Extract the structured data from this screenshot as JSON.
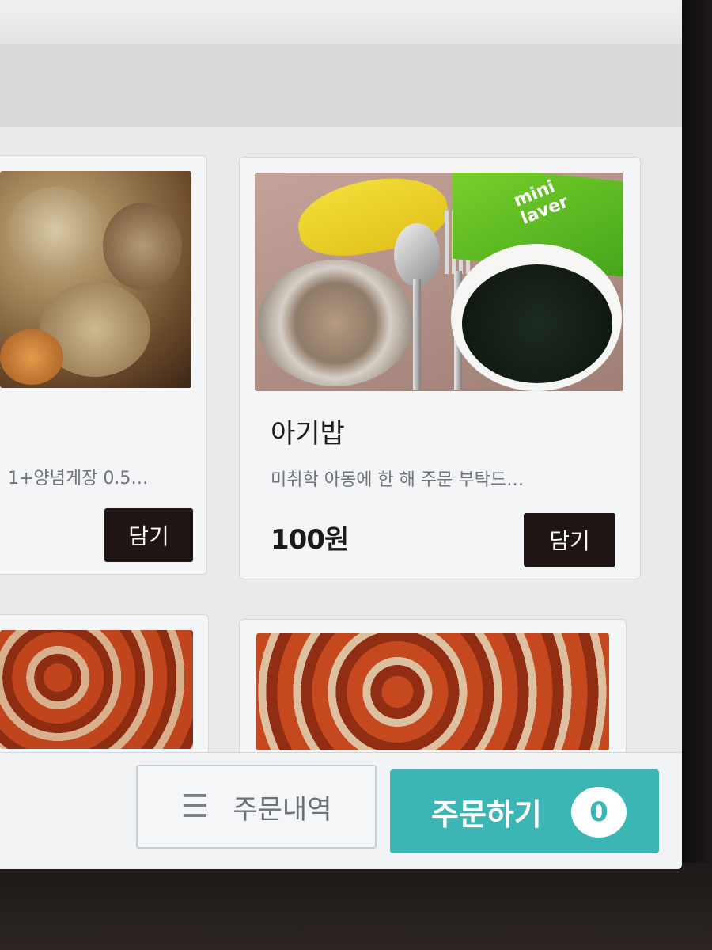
{
  "menu": {
    "items": [
      {
        "title": "",
        "description": "1+양념게장 0.5…",
        "price": "",
        "add_label": "담기"
      },
      {
        "title": "아기밥",
        "description": "미취학 아동에 한 해 주문 부탁드…",
        "price": "100원",
        "add_label": "담기",
        "photo_text": "mini laver"
      }
    ]
  },
  "action_bar": {
    "history_label": "주문내역",
    "history_icon": "menu-lines-icon",
    "order_label": "주문하기",
    "cart_count": "0"
  },
  "colors": {
    "accent": "#3bb6b4",
    "button_dark": "#1e1514"
  }
}
